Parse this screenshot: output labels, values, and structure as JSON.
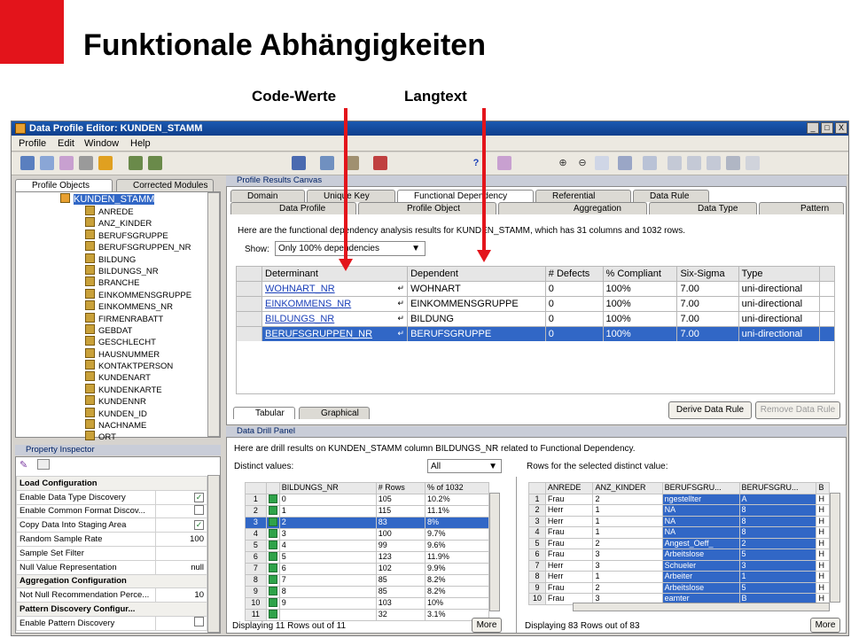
{
  "slide": {
    "title": "Funktionale Abhängigkeiten",
    "callout_left": "Code-Werte",
    "callout_right": "Langtext",
    "accent_color": "#e3141b"
  },
  "window": {
    "title": "Data Profile Editor: KUNDEN_STAMM",
    "menu": [
      "Profile",
      "Edit",
      "Window",
      "Help"
    ],
    "controls": [
      "_",
      "□",
      "X"
    ]
  },
  "left": {
    "tabs": [
      "Profile Objects",
      "Corrected Modules"
    ],
    "tree_root": "KUNDEN_STAMM",
    "tree_items": [
      "ANREDE",
      "ANZ_KINDER",
      "BERUFSGRUPPE",
      "BERUFSGRUPPEN_NR",
      "BILDUNG",
      "BILDUNGS_NR",
      "BRANCHE",
      "EINKOMMENSGRUPPE",
      "EINKOMMENS_NR",
      "FIRMENRABATT",
      "GEBDAT",
      "GESCHLECHT",
      "HAUSNUMMER",
      "KONTAKTPERSON",
      "KUNDENART",
      "KUNDENKARTE",
      "KUNDENNR",
      "KUNDEN_ID",
      "NACHNAME",
      "ORT"
    ]
  },
  "property_inspector": {
    "title": "Property Inspector",
    "rows": [
      {
        "section": true,
        "label": "Load Configuration"
      },
      {
        "label": "Enable Data Type Discovery",
        "check": "✓"
      },
      {
        "label": "Enable Common Format Discov...",
        "check": ""
      },
      {
        "label": "Copy Data Into Staging Area",
        "check": "✓"
      },
      {
        "label": "Random Sample Rate",
        "value": "100"
      },
      {
        "label": "Sample Set Filter",
        "value": ""
      },
      {
        "label": "Null Value Representation",
        "value": "null"
      },
      {
        "section": true,
        "label": "Aggregation Configuration"
      },
      {
        "label": "Not Null Recommendation Perce...",
        "value": "10"
      },
      {
        "section": true,
        "label": "Pattern Discovery Configur..."
      },
      {
        "label": "Enable Pattern Discovery",
        "check": ""
      }
    ]
  },
  "canvas": {
    "title": "Profile Results Canvas",
    "tabs_row1": [
      "Domain",
      "Unique Key",
      "Functional Dependency",
      "Referential",
      "Data Rule"
    ],
    "tabs_row2": [
      "Data Profile",
      "Profile Object",
      "Aggregation",
      "Data Type",
      "Pattern"
    ],
    "info": "Here are the functional dependency analysis results for KUNDEN_STAMM, which has 31 columns and 1032 rows.",
    "show_label": "Show:",
    "show_value": "Only 100% dependencies",
    "columns": [
      "Determinant",
      "Dependent",
      "# Defects",
      "% Compliant",
      "Six-Sigma",
      "Type"
    ],
    "rows": [
      [
        "WOHNART_NR",
        "WOHNART",
        "0",
        "100%",
        "7.00",
        "uni-directional"
      ],
      [
        "EINKOMMENS_NR",
        "EINKOMMENSGRUPPE",
        "0",
        "100%",
        "7.00",
        "uni-directional"
      ],
      [
        "BILDUNGS_NR",
        "BILDUNG",
        "0",
        "100%",
        "7.00",
        "uni-directional"
      ],
      [
        "BERUFSGRUPPEN_NR",
        "BERUFSGRUPPE",
        "0",
        "100%",
        "7.00",
        "uni-directional"
      ]
    ],
    "derive_button": "Derive Data Rule",
    "remove_button": "Remove Data Rule",
    "view_tabs": [
      "Tabular",
      "Graphical"
    ]
  },
  "drill": {
    "title": "Data Drill Panel",
    "info": "Here are drill results on KUNDEN_STAMM column BILDUNGS_NR related to Functional Dependency.",
    "distinct_label": "Distinct values:",
    "distinct_value": "All",
    "rows_label": "Rows for the selected distinct value:",
    "left_columns": [
      "",
      "",
      "BILDUNGS_NR",
      "# Rows",
      "% of 1032"
    ],
    "left_rows": [
      [
        "1",
        "0",
        "105",
        "10.2%"
      ],
      [
        "2",
        "1",
        "115",
        "11.1%"
      ],
      [
        "3",
        "2",
        "83",
        "8%"
      ],
      [
        "4",
        "3",
        "100",
        "9.7%"
      ],
      [
        "5",
        "4",
        "99",
        "9.6%"
      ],
      [
        "6",
        "5",
        "123",
        "11.9%"
      ],
      [
        "7",
        "6",
        "102",
        "9.9%"
      ],
      [
        "8",
        "7",
        "85",
        "8.2%"
      ],
      [
        "9",
        "8",
        "85",
        "8.2%"
      ],
      [
        "10",
        "9",
        "103",
        "10%"
      ],
      [
        "11",
        "",
        "32",
        "3.1%"
      ]
    ],
    "left_footer": "Displaying 11 Rows out of 11",
    "right_columns": [
      "",
      "ANREDE",
      "ANZ_KINDER",
      "BERUFSGRU...",
      "BERUFSGRU...",
      "B"
    ],
    "right_rows": [
      [
        "1",
        "Frau",
        "2",
        "ngestellter",
        "A",
        "H"
      ],
      [
        "2",
        "Herr",
        "1",
        "NA",
        "8",
        "H"
      ],
      [
        "3",
        "Herr",
        "1",
        "NA",
        "8",
        "H"
      ],
      [
        "4",
        "Frau",
        "1",
        "NA",
        "8",
        "H"
      ],
      [
        "5",
        "Frau",
        "2",
        "Angest_Oeff_",
        "2",
        "H"
      ],
      [
        "6",
        "Frau",
        "3",
        "Arbeitslose",
        "5",
        "H"
      ],
      [
        "7",
        "Herr",
        "3",
        "Schueler",
        "3",
        "H"
      ],
      [
        "8",
        "Herr",
        "1",
        "Arbeiter",
        "1",
        "H"
      ],
      [
        "9",
        "Frau",
        "2",
        "Arbeitslose",
        "5",
        "H"
      ],
      [
        "10",
        "Frau",
        "3",
        "eamter",
        "B",
        "H"
      ]
    ],
    "right_footer": "Displaying 83 Rows out of 83",
    "more": "More"
  }
}
